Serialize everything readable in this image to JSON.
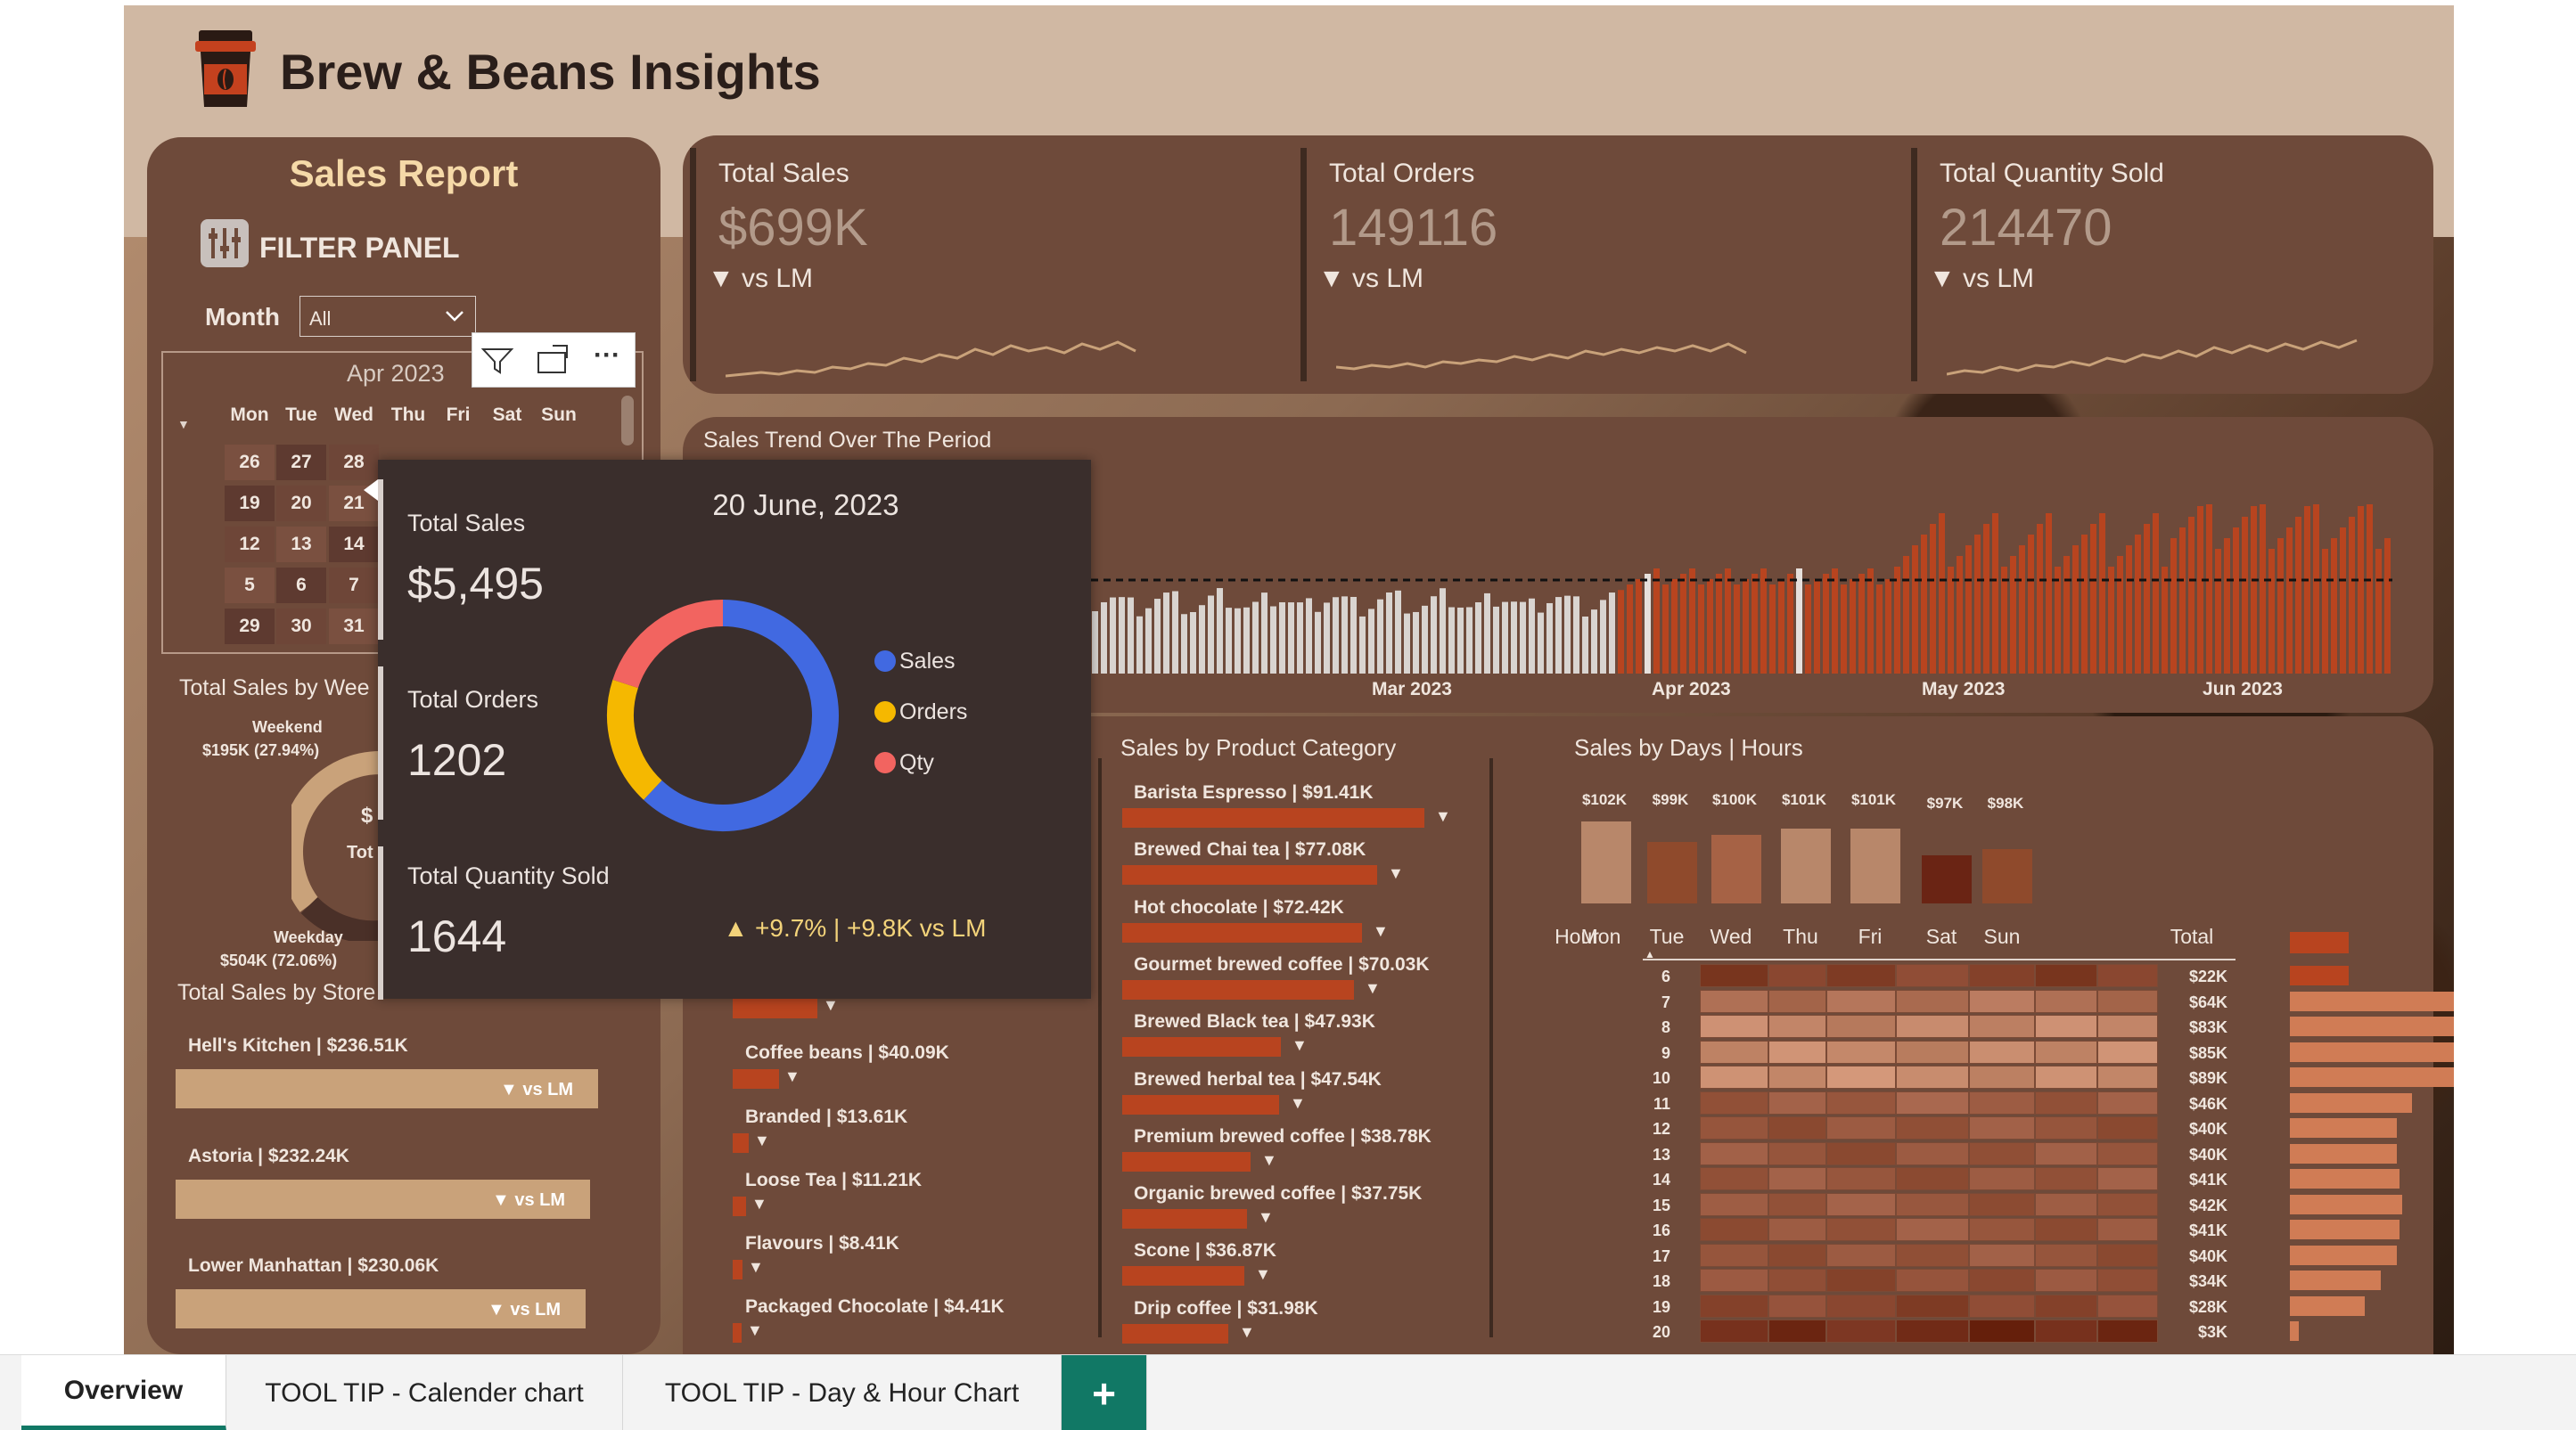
{
  "app": {
    "title": "Brew & Beans Insights"
  },
  "filter": {
    "report_title": "Sales Report",
    "panel_label": "FILTER PANEL",
    "month_label": "Month",
    "month_value": "All"
  },
  "calendar": {
    "title": "Apr 2023",
    "days": [
      "Mon",
      "Tue",
      "Wed",
      "Thu",
      "Fri",
      "Sat",
      "Sun"
    ],
    "rows": [
      [
        "26",
        "27",
        "28"
      ],
      [
        "19",
        "20",
        "21"
      ],
      [
        "12",
        "13",
        "14"
      ],
      [
        "5",
        "6",
        "7"
      ],
      [
        "29",
        "30",
        "31"
      ]
    ]
  },
  "kpis": [
    {
      "title": "Total Sales",
      "value": "$699K",
      "vs": "vs LM"
    },
    {
      "title": "Total Orders",
      "value": "149116",
      "vs": "vs LM"
    },
    {
      "title": "Total Quantity Sold",
      "value": "214470",
      "vs": "vs LM"
    }
  ],
  "trend": {
    "title": "Sales Trend Over The Period",
    "months": [
      "Mar 2023",
      "Apr 2023",
      "May 2023",
      "Jun 2023"
    ]
  },
  "weekday": {
    "title": "Total Sales by Wee",
    "weekend_label": "Weekend",
    "weekend_value": "$195K (27.94%)",
    "weekday_label": "Weekday",
    "weekday_value": "$504K (72.06%)",
    "center_a": "$",
    "center_b": "Tot"
  },
  "stores": {
    "title": "Total Sales by Store",
    "items": [
      {
        "label": "Hell's Kitchen | $236.51K",
        "vs": "▼ vs LM",
        "fraction": 1.0
      },
      {
        "label": "Astoria | $232.24K",
        "vs": "▼ vs LM",
        "fraction": 0.98
      },
      {
        "label": "Lower Manhattan | $230.06K",
        "vs": "▼ vs LM",
        "fraction": 0.97
      }
    ]
  },
  "left_categories": [
    {
      "label": "Coffee beans | $40.09K",
      "value": 40.09
    },
    {
      "label": "Branded | $13.61K",
      "value": 13.61
    },
    {
      "label": "Loose Tea | $11.21K",
      "value": 11.21
    },
    {
      "label": "Flavours | $8.41K",
      "value": 8.41
    },
    {
      "label": "Packaged Chocolate | $4.41K",
      "value": 4.41
    }
  ],
  "product": {
    "title": "Sales by Product Category",
    "items": [
      {
        "label": "Barista Espresso | $91.41K",
        "value": 91.41
      },
      {
        "label": "Brewed Chai tea | $77.08K",
        "value": 77.08
      },
      {
        "label": "Hot chocolate | $72.42K",
        "value": 72.42
      },
      {
        "label": "Gourmet brewed coffee | $70.03K",
        "value": 70.03
      },
      {
        "label": "Brewed Black tea | $47.93K",
        "value": 47.93
      },
      {
        "label": "Brewed herbal tea | $47.54K",
        "value": 47.54
      },
      {
        "label": "Premium brewed coffee | $38.78K",
        "value": 38.78
      },
      {
        "label": "Organic brewed coffee | $37.75K",
        "value": 37.75
      },
      {
        "label": "Scone | $36.87K",
        "value": 36.87
      },
      {
        "label": "Drip coffee | $31.98K",
        "value": 31.98
      }
    ]
  },
  "days_hours": {
    "title": "Sales by Days | Hours",
    "hour_label": "Hour",
    "total_label": "Total",
    "days": [
      "Mon",
      "Tue",
      "Wed",
      "Thu",
      "Fri",
      "Sat",
      "Sun"
    ],
    "day_totals": [
      "$102K",
      "$99K",
      "$100K",
      "$101K",
      "$101K",
      "$97K",
      "$98K"
    ],
    "day_values": [
      102,
      99,
      100,
      101,
      101,
      97,
      98
    ],
    "hours": [
      "6",
      "7",
      "8",
      "9",
      "10",
      "11",
      "12",
      "13",
      "14",
      "15",
      "16",
      "17",
      "18",
      "19",
      "20"
    ],
    "hour_totals": [
      "$22K",
      "$64K",
      "$83K",
      "$85K",
      "$89K",
      "$46K",
      "$40K",
      "$40K",
      "$41K",
      "$42K",
      "$41K",
      "$40K",
      "$34K",
      "$28K",
      "$3K"
    ],
    "hour_values": [
      22,
      64,
      83,
      85,
      89,
      46,
      40,
      40,
      41,
      42,
      41,
      40,
      34,
      28,
      3
    ]
  },
  "tooltip": {
    "date": "20 June, 2023",
    "sales_label": "Total Sales",
    "sales_value": "$5,495",
    "orders_label": "Total Orders",
    "orders_value": "1202",
    "qty_label": "Total Quantity Sold",
    "qty_value": "1644",
    "legend": [
      "Sales",
      "Orders",
      "Qty"
    ],
    "donut_shares": [
      0.62,
      0.18,
      0.2
    ],
    "colors": [
      "#4169e1",
      "#f5b800",
      "#f26460"
    ],
    "delta": "▲ +9.7% | +9.8K vs LM"
  },
  "tabs": {
    "overview": "Overview",
    "calendar": "TOOL TIP - Calender chart",
    "dayhour": "TOOL TIP - Day & Hour Chart",
    "add": "+"
  },
  "colors": {
    "panel": "#6e4a3a",
    "accent": "#b8441f",
    "tan": "#c9a27a"
  }
}
